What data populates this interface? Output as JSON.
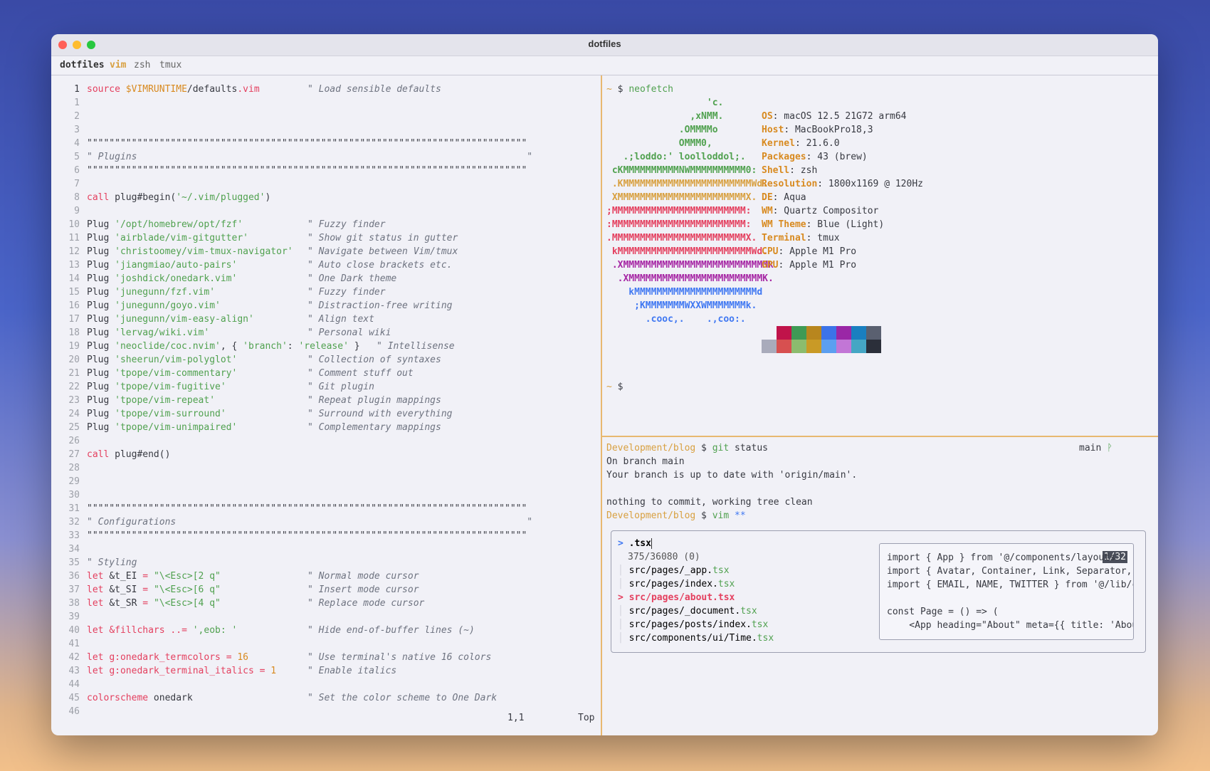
{
  "window": {
    "title": "dotfiles"
  },
  "tabs": {
    "session": "dotfiles",
    "items": [
      "vim",
      "zsh",
      "tmux"
    ],
    "active": "vim"
  },
  "vim": {
    "lines": [
      {
        "n": "1",
        "cur": true,
        "parts": [
          [
            "kw",
            "source "
          ],
          [
            "var",
            "$VIMRUNTIME"
          ],
          [
            "",
            "/defaults"
          ],
          [
            "kw",
            ".vim"
          ],
          [
            "pad",
            ""
          ],
          [
            "cmt",
            "\" Load sensible defaults"
          ]
        ]
      },
      {
        "n": "1",
        "parts": []
      },
      {
        "n": "2",
        "parts": []
      },
      {
        "n": "3",
        "parts": []
      },
      {
        "n": "4",
        "parts": [
          [
            "hash",
            "\"\"\"\"\"\"\"\"\"\"\"\"\"\"\"\"\"\"\"\"\"\"\"\"\"\"\"\"\"\"\"\"\"\"\"\"\"\"\"\"\"\"\"\"\"\"\"\"\"\"\"\"\"\"\"\"\"\"\"\"\"\"\"\"\"\"\"\"\"\"\"\"\"\"\"\"\"\"\""
          ]
        ]
      },
      {
        "n": "5",
        "parts": [
          [
            "cmt",
            "\" Plugins                                                                      \""
          ]
        ]
      },
      {
        "n": "6",
        "parts": [
          [
            "hash",
            "\"\"\"\"\"\"\"\"\"\"\"\"\"\"\"\"\"\"\"\"\"\"\"\"\"\"\"\"\"\"\"\"\"\"\"\"\"\"\"\"\"\"\"\"\"\"\"\"\"\"\"\"\"\"\"\"\"\"\"\"\"\"\"\"\"\"\"\"\"\"\"\"\"\"\"\"\"\"\""
          ]
        ]
      },
      {
        "n": "7",
        "parts": []
      },
      {
        "n": "8",
        "parts": [
          [
            "kw",
            "call "
          ],
          [
            "",
            "plug#begin("
          ],
          [
            "str",
            "'~/.vim/plugged'"
          ],
          [
            "",
            ")"
          ]
        ]
      },
      {
        "n": "9",
        "parts": []
      },
      {
        "n": "10",
        "parts": [
          [
            "",
            "Plug "
          ],
          [
            "str",
            "'/opt/homebrew/opt/fzf'"
          ],
          [
            "pad",
            ""
          ],
          [
            "cmt",
            "\" Fuzzy finder"
          ]
        ]
      },
      {
        "n": "11",
        "parts": [
          [
            "",
            "Plug "
          ],
          [
            "str",
            "'airblade/vim-gitgutter'"
          ],
          [
            "pad",
            ""
          ],
          [
            "cmt",
            "\" Show git status in gutter"
          ]
        ]
      },
      {
        "n": "12",
        "parts": [
          [
            "",
            "Plug "
          ],
          [
            "str",
            "'christoomey/vim-tmux-navigator'"
          ],
          [
            "pad",
            ""
          ],
          [
            "cmt",
            "\" Navigate between Vim/tmux"
          ]
        ]
      },
      {
        "n": "13",
        "parts": [
          [
            "",
            "Plug "
          ],
          [
            "str",
            "'jiangmiao/auto-pairs'"
          ],
          [
            "pad",
            ""
          ],
          [
            "cmt",
            "\" Auto close brackets etc."
          ]
        ]
      },
      {
        "n": "14",
        "parts": [
          [
            "",
            "Plug "
          ],
          [
            "str",
            "'joshdick/onedark.vim'"
          ],
          [
            "pad",
            ""
          ],
          [
            "cmt",
            "\" One Dark theme"
          ]
        ]
      },
      {
        "n": "15",
        "parts": [
          [
            "",
            "Plug "
          ],
          [
            "str",
            "'junegunn/fzf.vim'"
          ],
          [
            "pad",
            ""
          ],
          [
            "cmt",
            "\" Fuzzy finder"
          ]
        ]
      },
      {
        "n": "16",
        "parts": [
          [
            "",
            "Plug "
          ],
          [
            "str",
            "'junegunn/goyo.vim'"
          ],
          [
            "pad",
            ""
          ],
          [
            "cmt",
            "\" Distraction-free writing"
          ]
        ]
      },
      {
        "n": "17",
        "parts": [
          [
            "",
            "Plug "
          ],
          [
            "str",
            "'junegunn/vim-easy-align'"
          ],
          [
            "pad",
            ""
          ],
          [
            "cmt",
            "\" Align text"
          ]
        ]
      },
      {
        "n": "18",
        "parts": [
          [
            "",
            "Plug "
          ],
          [
            "str",
            "'lervag/wiki.vim'"
          ],
          [
            "pad",
            ""
          ],
          [
            "cmt",
            "\" Personal wiki"
          ]
        ]
      },
      {
        "n": "19",
        "parts": [
          [
            "",
            "Plug "
          ],
          [
            "str",
            "'neoclide/coc.nvim'"
          ],
          [
            "",
            ", { "
          ],
          [
            "str",
            "'branch'"
          ],
          [
            "",
            ": "
          ],
          [
            "str",
            "'release'"
          ],
          [
            "",
            " }   "
          ],
          [
            "cmt",
            "\" Intellisense"
          ]
        ]
      },
      {
        "n": "20",
        "parts": [
          [
            "",
            "Plug "
          ],
          [
            "str",
            "'sheerun/vim-polyglot'"
          ],
          [
            "pad",
            ""
          ],
          [
            "cmt",
            "\" Collection of syntaxes"
          ]
        ]
      },
      {
        "n": "21",
        "parts": [
          [
            "",
            "Plug "
          ],
          [
            "str",
            "'tpope/vim-commentary'"
          ],
          [
            "pad",
            ""
          ],
          [
            "cmt",
            "\" Comment stuff out"
          ]
        ]
      },
      {
        "n": "22",
        "parts": [
          [
            "",
            "Plug "
          ],
          [
            "str",
            "'tpope/vim-fugitive'"
          ],
          [
            "pad",
            ""
          ],
          [
            "cmt",
            "\" Git plugin"
          ]
        ]
      },
      {
        "n": "23",
        "parts": [
          [
            "",
            "Plug "
          ],
          [
            "str",
            "'tpope/vim-repeat'"
          ],
          [
            "pad",
            ""
          ],
          [
            "cmt",
            "\" Repeat plugin mappings"
          ]
        ]
      },
      {
        "n": "24",
        "parts": [
          [
            "",
            "Plug "
          ],
          [
            "str",
            "'tpope/vim-surround'"
          ],
          [
            "pad",
            ""
          ],
          [
            "cmt",
            "\" Surround with everything"
          ]
        ]
      },
      {
        "n": "25",
        "parts": [
          [
            "",
            "Plug "
          ],
          [
            "str",
            "'tpope/vim-unimpaired'"
          ],
          [
            "pad",
            ""
          ],
          [
            "cmt",
            "\" Complementary mappings"
          ]
        ]
      },
      {
        "n": "26",
        "parts": []
      },
      {
        "n": "27",
        "parts": [
          [
            "kw",
            "call "
          ],
          [
            "",
            "plug#end()"
          ]
        ]
      },
      {
        "n": "28",
        "parts": []
      },
      {
        "n": "29",
        "parts": []
      },
      {
        "n": "30",
        "parts": []
      },
      {
        "n": "31",
        "parts": [
          [
            "hash",
            "\"\"\"\"\"\"\"\"\"\"\"\"\"\"\"\"\"\"\"\"\"\"\"\"\"\"\"\"\"\"\"\"\"\"\"\"\"\"\"\"\"\"\"\"\"\"\"\"\"\"\"\"\"\"\"\"\"\"\"\"\"\"\"\"\"\"\"\"\"\"\"\"\"\"\"\"\"\"\""
          ]
        ]
      },
      {
        "n": "32",
        "parts": [
          [
            "cmt",
            "\" Configurations                                                               \""
          ]
        ]
      },
      {
        "n": "33",
        "parts": [
          [
            "hash",
            "\"\"\"\"\"\"\"\"\"\"\"\"\"\"\"\"\"\"\"\"\"\"\"\"\"\"\"\"\"\"\"\"\"\"\"\"\"\"\"\"\"\"\"\"\"\"\"\"\"\"\"\"\"\"\"\"\"\"\"\"\"\"\"\"\"\"\"\"\"\"\"\"\"\"\"\"\"\"\""
          ]
        ]
      },
      {
        "n": "34",
        "parts": []
      },
      {
        "n": "35",
        "parts": [
          [
            "cmt",
            "\" Styling"
          ]
        ]
      },
      {
        "n": "36",
        "parts": [
          [
            "kw",
            "let "
          ],
          [
            "",
            "&t_EI "
          ],
          [
            "kw",
            "= "
          ],
          [
            "str",
            "\"\\<Esc>[2 q\""
          ],
          [
            "pad",
            ""
          ],
          [
            "cmt",
            "\" Normal mode cursor"
          ]
        ]
      },
      {
        "n": "37",
        "parts": [
          [
            "kw",
            "let "
          ],
          [
            "",
            "&t_SI "
          ],
          [
            "kw",
            "= "
          ],
          [
            "str",
            "\"\\<Esc>[6 q\""
          ],
          [
            "pad",
            ""
          ],
          [
            "cmt",
            "\" Insert mode cursor"
          ]
        ]
      },
      {
        "n": "38",
        "parts": [
          [
            "kw",
            "let "
          ],
          [
            "",
            "&t_SR "
          ],
          [
            "kw",
            "= "
          ],
          [
            "str",
            "\"\\<Esc>[4 q\""
          ],
          [
            "pad",
            ""
          ],
          [
            "cmt",
            "\" Replace mode cursor"
          ]
        ]
      },
      {
        "n": "39",
        "parts": []
      },
      {
        "n": "40",
        "parts": [
          [
            "kw",
            "let "
          ],
          [
            "kw",
            "&fillchars "
          ],
          [
            "kw",
            ".."
          ],
          [
            "kw",
            "= "
          ],
          [
            "str",
            "',eob: '"
          ],
          [
            "pad",
            ""
          ],
          [
            "cmt",
            "\" Hide end-of-buffer lines (~)"
          ]
        ]
      },
      {
        "n": "41",
        "parts": []
      },
      {
        "n": "42",
        "parts": [
          [
            "kw",
            "let "
          ],
          [
            "kw",
            "g:onedark_termcolors "
          ],
          [
            "kw",
            "= "
          ],
          [
            "num",
            "16"
          ],
          [
            "pad",
            ""
          ],
          [
            "cmt",
            "\" Use terminal's native 16 colors"
          ]
        ]
      },
      {
        "n": "43",
        "parts": [
          [
            "kw",
            "let "
          ],
          [
            "kw",
            "g:onedark_terminal_italics "
          ],
          [
            "kw",
            "= "
          ],
          [
            "num",
            "1"
          ],
          [
            "pad",
            ""
          ],
          [
            "cmt",
            "\" Enable italics"
          ]
        ]
      },
      {
        "n": "44",
        "parts": []
      },
      {
        "n": "45",
        "parts": [
          [
            "kw",
            "colorscheme "
          ],
          [
            "",
            "onedark"
          ],
          [
            "pad",
            ""
          ],
          [
            "cmt",
            "\" Set the color scheme to One Dark"
          ]
        ]
      },
      {
        "n": "46",
        "parts": []
      }
    ],
    "status_pos": "1,1",
    "status_scroll": "Top"
  },
  "neofetch": {
    "prompt": "~ $",
    "command": "neofetch",
    "logo": [
      {
        "t": "                  'c.",
        "c": "#50a14f"
      },
      {
        "t": "               ,xNMM.",
        "c": "#50a14f"
      },
      {
        "t": "             .OMMMMo",
        "c": "#50a14f"
      },
      {
        "t": "             OMMM0,",
        "c": "#50a14f"
      },
      {
        "t": "   .;loddo:' loolloddol;.",
        "c": "#50a14f"
      },
      {
        "t": " cKMMMMMMMMMMNWMMMMMMMMMM0:",
        "c": "#50a14f"
      },
      {
        "t": " .KMMMMMMMMMMMMMMMMMMMMMMMWd.",
        "c": "#d8a040"
      },
      {
        "t": " XMMMMMMMMMMMMMMMMMMMMMMMX.",
        "c": "#d8a040"
      },
      {
        "t": ";MMMMMMMMMMMMMMMMMMMMMMMM:",
        "c": "#e4405f"
      },
      {
        "t": ":MMMMMMMMMMMMMMMMMMMMMMMM:",
        "c": "#e4405f"
      },
      {
        "t": ".MMMMMMMMMMMMMMMMMMMMMMMMX.",
        "c": "#e4405f"
      },
      {
        "t": " kMMMMMMMMMMMMMMMMMMMMMMMMWd.",
        "c": "#e4405f"
      },
      {
        "t": " .XMMMMMMMMMMMMMMMMMMMMMMMMMMk",
        "c": "#a626a4"
      },
      {
        "t": "  .XMMMMMMMMMMMMMMMMMMMMMMMMK.",
        "c": "#a626a4"
      },
      {
        "t": "    kMMMMMMMMMMMMMMMMMMMMMMd",
        "c": "#4078f2"
      },
      {
        "t": "     ;KMMMMMMMWXXWMMMMMMMk.",
        "c": "#4078f2"
      },
      {
        "t": "       .cooc,.    .,coo:.",
        "c": "#4078f2"
      }
    ],
    "info": [
      {
        "k": "OS",
        "v": ": macOS 12.5 21G72 arm64"
      },
      {
        "k": "Host",
        "v": ": MacBookPro18,3"
      },
      {
        "k": "Kernel",
        "v": ": 21.6.0"
      },
      {
        "k": "Packages",
        "v": ": 43 (brew)"
      },
      {
        "k": "Shell",
        "v": ": zsh"
      },
      {
        "k": "Resolution",
        "v": ": 1800x1169 @ 120Hz"
      },
      {
        "k": "DE",
        "v": ": Aqua"
      },
      {
        "k": "WM",
        "v": ": Quartz Compositor"
      },
      {
        "k": "WM Theme",
        "v": ": Blue (Light)"
      },
      {
        "k": "Terminal",
        "v": ": tmux"
      },
      {
        "k": "CPU",
        "v": ": Apple M1 Pro"
      },
      {
        "k": "GPU",
        "v": ": Apple M1 Pro"
      }
    ],
    "palette_top": [
      "#f1f1f7",
      "#c0134a",
      "#3f9a55",
      "#b8861e",
      "#3c73e8",
      "#9a27a6",
      "#1a7fc0",
      "#5a6070"
    ],
    "palette_bottom": [
      "#a9abbb",
      "#d75050",
      "#8cbc6e",
      "#c99a26",
      "#5c9ff0",
      "#c276d6",
      "#45a6c4",
      "#2b2f3a"
    ],
    "end_prompt": "~ $"
  },
  "git": {
    "dir": "Development/blog",
    "prompt_sign": "$",
    "cmd1": "git",
    "cmd1_args": "status",
    "branch_badge": "main",
    "output": [
      "On branch main",
      "Your branch is up to date with 'origin/main'.",
      "",
      "nothing to commit, working tree clean"
    ],
    "cmd2": "vim",
    "cmd2_args": "**"
  },
  "fzf": {
    "prompt": ">",
    "query": ".tsx",
    "count": "375/36080 (0)",
    "items": [
      {
        "path": "src/pages/_app.",
        "ext": "tsx",
        "selected": false
      },
      {
        "path": "src/pages/index.",
        "ext": "tsx",
        "selected": false
      },
      {
        "path": "src/pages/about.",
        "ext": "tsx",
        "selected": true
      },
      {
        "path": "src/pages/_document.",
        "ext": "tsx",
        "selected": false
      },
      {
        "path": "src/pages/posts/index.",
        "ext": "tsx",
        "selected": false
      },
      {
        "path": "src/components/ui/Time.",
        "ext": "tsx",
        "selected": false
      }
    ],
    "preview_counter": "1/32",
    "preview_lines": [
      "import { App } from '@/components/layouts'",
      "import { Avatar, Container, Link, Separator, Tex",
      "import { EMAIL, NAME, TWITTER } from '@/lib/cons",
      "",
      "const Page = () => (",
      "    <App heading=\"About\" meta={{ title: 'About',"
    ]
  }
}
